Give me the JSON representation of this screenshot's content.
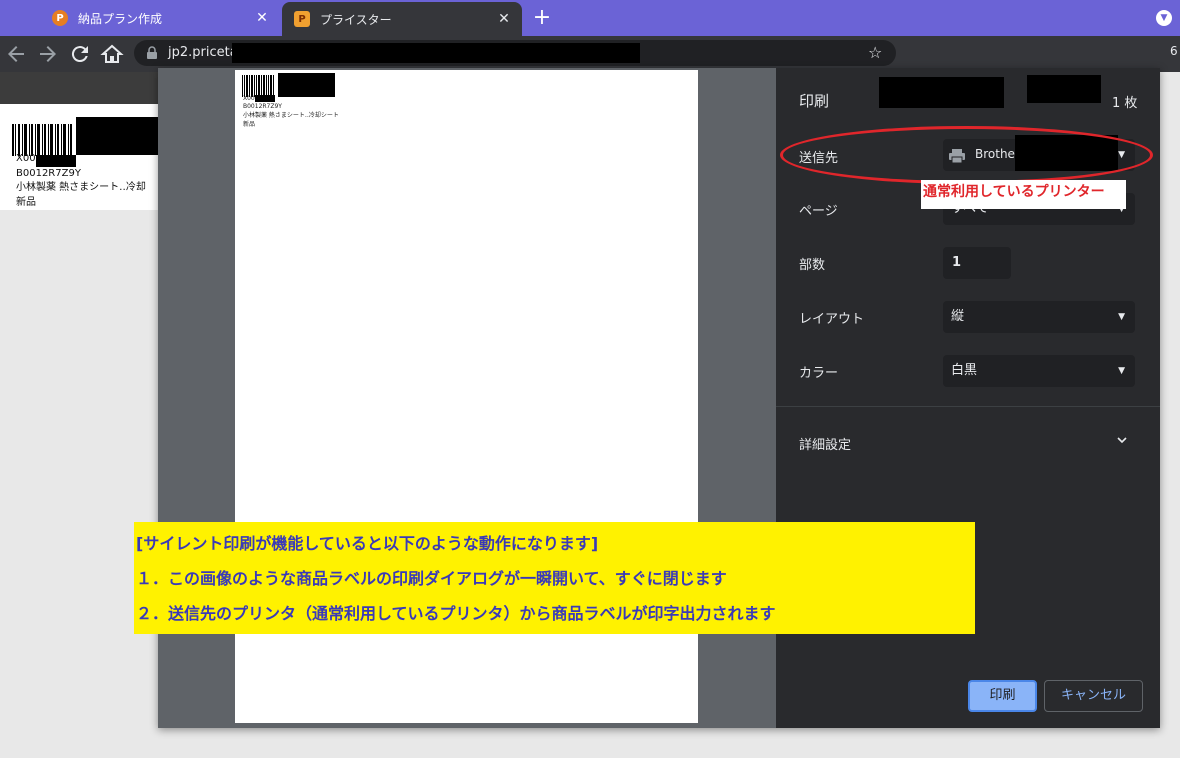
{
  "browser": {
    "tabs": [
      {
        "title": "納品プラン作成",
        "favicon": "P",
        "close": "✕"
      },
      {
        "title": "プライスター",
        "favicon": "P",
        "close": "✕"
      }
    ],
    "new_tab": "+",
    "tab_search": "▼",
    "url": "jp2.pricetar",
    "right_stub": "6"
  },
  "background_label": {
    "code_line": "X00",
    "asin": "B0012R7Z9Y",
    "product": "小林製薬 熱さまシート‥冷却",
    "condition": "新品"
  },
  "preview_label": {
    "code_line": "X00",
    "asin": "B0012R7Z9Y",
    "product": "小林製薬 熱さまシート‥冷却シート",
    "condition": "新品"
  },
  "print_dialog": {
    "title": "印刷",
    "sheet_count": "1 枚",
    "destination": {
      "label": "送信先",
      "value": "Brother",
      "icon": "printer-icon"
    },
    "pages": {
      "label": "ページ",
      "value": "すべて"
    },
    "copies": {
      "label": "部数",
      "value": "1"
    },
    "layout": {
      "label": "レイアウト",
      "value": "縦"
    },
    "color": {
      "label": "カラー",
      "value": "白黒"
    },
    "advanced": {
      "label": "詳細設定"
    },
    "print_button": "印刷",
    "cancel_button": "キャンセル"
  },
  "annotations": {
    "callout": "通常利用しているプリンター",
    "note_lines": [
      "[サイレント印刷が機能していると以下のような動作になります]",
      "１．この画像のような商品ラベルの印刷ダイアログが一瞬開いて、すぐに閉じます",
      "２．送信先のプリンタ（通常利用しているプリンタ）から商品ラベルが印字出力されます"
    ]
  },
  "colors": {
    "tabstrip": "#6b63d6",
    "dialog_panel": "#292a2d",
    "accent": "#8ab4f8",
    "annotation_red": "#e0262b",
    "annotation_yellow": "#fff200",
    "annotation_text": "#3a3ab8"
  }
}
